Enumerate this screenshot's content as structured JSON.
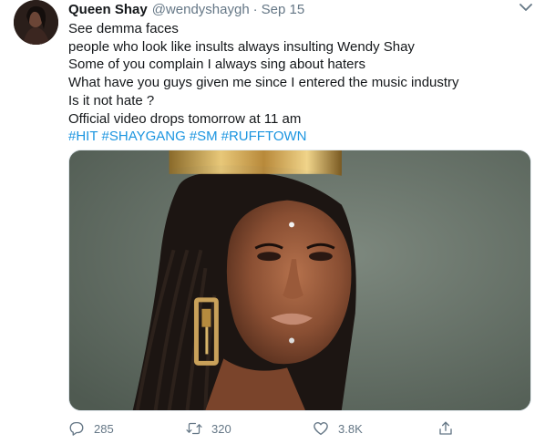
{
  "tweet": {
    "author": {
      "name": "Queen Shay",
      "handle": "@wendyshaygh",
      "separator": "·",
      "date": "Sep 15"
    },
    "lines": [
      "See demma faces",
      "people who look like insults always insulting Wendy Shay",
      "Some of you complain I always sing about haters",
      "What have you guys given me since I entered the music industry",
      "Is it not hate ?",
      "Official video drops tomorrow at 11 am"
    ],
    "hashtags": [
      "#HIT",
      "#SHAYGANG",
      "#SM",
      "#RUFFTOWN"
    ],
    "actions": {
      "replies": "285",
      "retweets": "320",
      "likes": "3.8K"
    },
    "icons": {
      "more": "chevron-down-icon",
      "reply": "reply-icon",
      "retweet": "retweet-icon",
      "like": "heart-icon",
      "share": "share-icon"
    },
    "colors": {
      "link": "#1b95e0",
      "secondary_text": "#657786",
      "primary_text": "#14171a"
    }
  }
}
